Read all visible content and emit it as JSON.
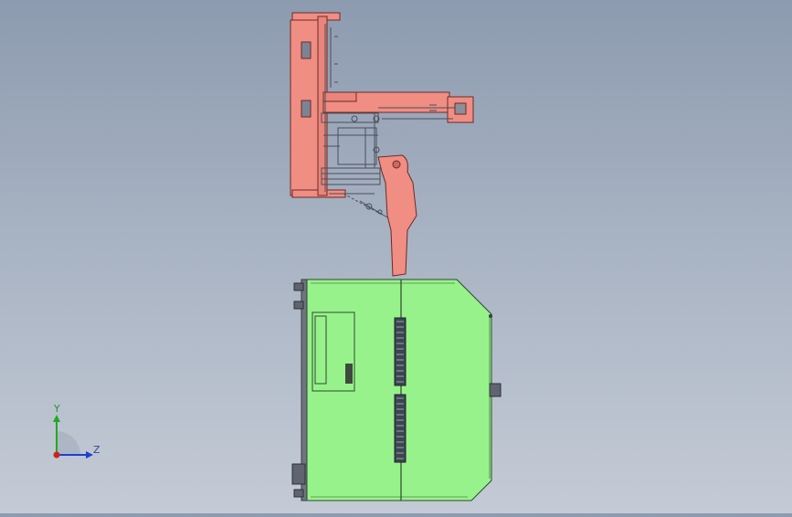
{
  "viewport": {
    "model": "cad-assembly-side-view",
    "colors": {
      "upper_assembly": "#f08e84",
      "upper_assembly_edge": "#6e2a25",
      "lower_cabinet": "#98f28c",
      "lower_cabinet_edge": "#2c4a2c",
      "steel": "#6f7480",
      "background_top": "#8d9bb0",
      "background_bottom": "#c4cbd6"
    }
  },
  "triad": {
    "y_label": "Y",
    "z_label": "Z",
    "y_color": "#1faa1f",
    "z_color": "#1f3fd0",
    "x_color": "#d01f1f"
  }
}
